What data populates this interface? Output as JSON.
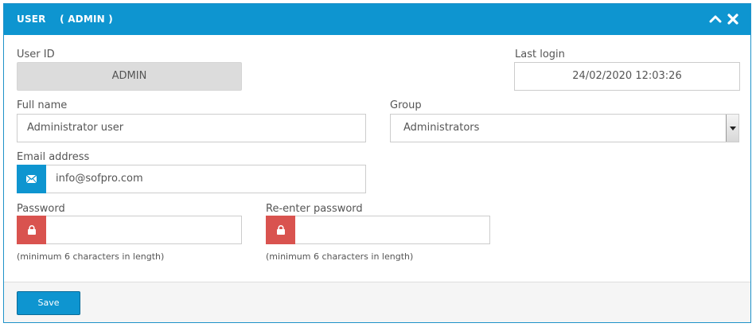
{
  "panel": {
    "title": "USER    ( ADMIN )",
    "collapse_icon": "chevron-up-icon",
    "close_icon": "close-icon"
  },
  "form": {
    "user_id": {
      "label": "User ID",
      "value": "ADMIN"
    },
    "last_login": {
      "label": "Last login",
      "value": "24/02/2020 12:03:26"
    },
    "full_name": {
      "label": "Full name",
      "value": "Administrator user"
    },
    "group": {
      "label": "Group",
      "selected": "Administrators"
    },
    "email": {
      "label": "Email address",
      "value": "info@sofpro.com",
      "icon": "envelope-icon"
    },
    "password": {
      "label": "Password",
      "value": "",
      "hint": "(minimum 6 characters in length)",
      "icon": "lock-icon"
    },
    "password_confirm": {
      "label": "Re-enter password",
      "value": "",
      "hint": "(minimum 6 characters in length)",
      "icon": "lock-icon"
    }
  },
  "footer": {
    "save_label": "Save"
  },
  "colors": {
    "accent": "#0e95d0",
    "danger": "#d9534f"
  }
}
